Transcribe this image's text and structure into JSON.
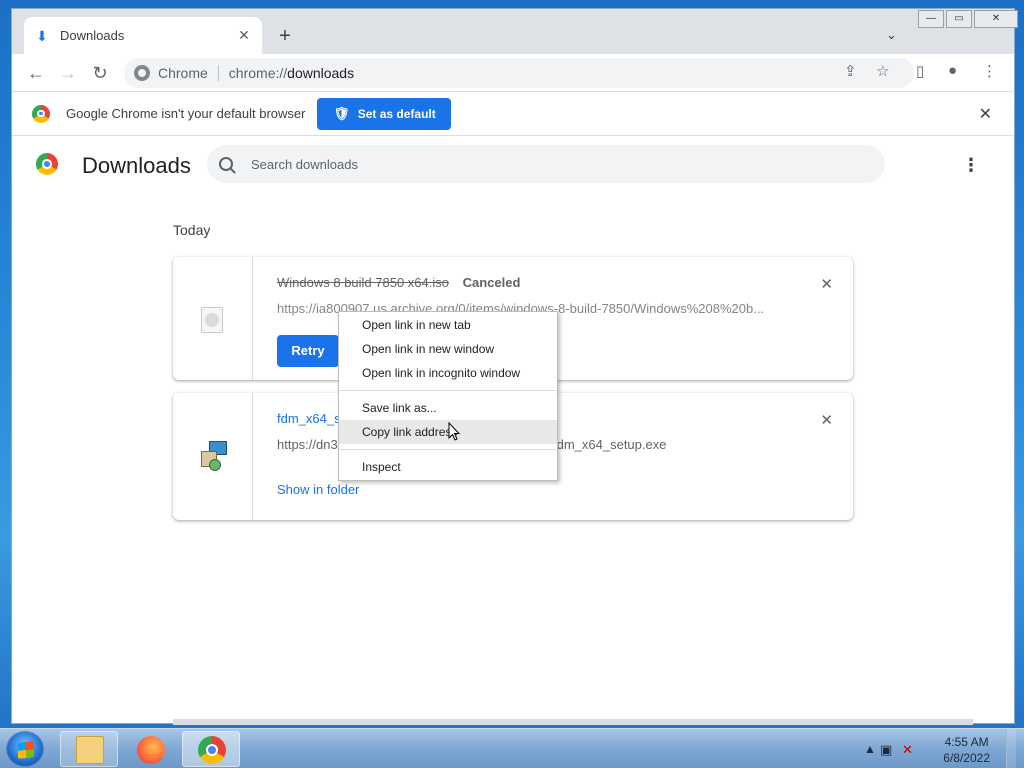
{
  "tab": {
    "title": "Downloads",
    "close": "✕"
  },
  "newtab": "+",
  "tabsearch": "⌄",
  "window_controls": {
    "minimize": "—",
    "maximize": "▭",
    "close": "✕"
  },
  "nav": {
    "back": "←",
    "forward": "→",
    "reload": "↻"
  },
  "omnibox": {
    "site": "Chrome",
    "scheme": "chrome://",
    "host": "downloads"
  },
  "toolbar_right": {
    "share": "⇪",
    "bookmark": "☆",
    "sidepanel": "▯",
    "profile": "●",
    "menu": "⋮"
  },
  "infobar": {
    "message": "Google Chrome isn't your default browser",
    "button": "Set as default",
    "close": "✕"
  },
  "downloads_page": {
    "title": "Downloads",
    "search_placeholder": "Search downloads",
    "menu": "⋮",
    "section": "Today"
  },
  "items": [
    {
      "filename": "Windows 8 build 7850 x64.iso",
      "status": "Canceled",
      "url": "https://ia800907.us.archive.org/0/items/windows-8-build-7850/Windows%208%20b...",
      "action": "Retry",
      "close": "✕"
    },
    {
      "filename": "fdm_x64_setup.exe",
      "filename_visible": "fdm_x64_s",
      "url_start": "https://dn3",
      "url_end": "fdm_x64_setup.exe",
      "action": "Show in folder",
      "close": "✕"
    }
  ],
  "context_menu": {
    "items": [
      "Open link in new tab",
      "Open link in new window",
      "Open link in incognito window"
    ],
    "items2": [
      "Save link as...",
      "Copy link address"
    ],
    "items3": [
      "Inspect"
    ],
    "highlighted": "Copy link address"
  },
  "taskbar": {
    "time": "4:55 AM",
    "date": "6/8/2022",
    "tray_arrow": "▲"
  },
  "colors": {
    "accent": "#1a73e8",
    "tab_strip": "#dee1e6",
    "taskbar": "#7fa8d4"
  }
}
